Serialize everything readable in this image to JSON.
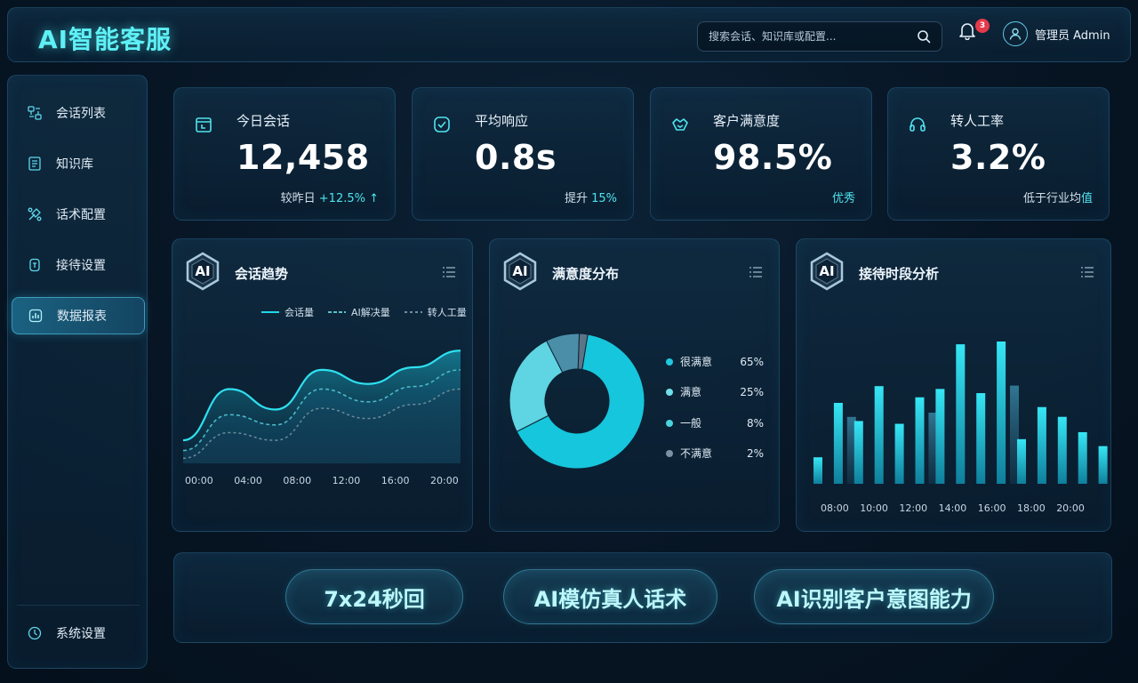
{
  "app": {
    "title": "AI智能客服"
  },
  "header": {
    "search_placeholder": "搜索会话、知识库或配置...",
    "notification_count": "3",
    "user_name": "管理员 Admin"
  },
  "sidebar": {
    "items": [
      {
        "label": "会话列表",
        "icon": "chat-list-icon"
      },
      {
        "label": "知识库",
        "icon": "knowledge-base-icon"
      },
      {
        "label": "话术配置",
        "icon": "script-config-icon"
      },
      {
        "label": "接待设置",
        "icon": "reception-icon"
      },
      {
        "label": "数据报表",
        "icon": "report-icon",
        "active": true
      }
    ],
    "footer_label": "系统设置"
  },
  "stats": [
    {
      "label": "今日会话",
      "value": "12,458",
      "note_prefix": "较昨日 ",
      "note_highlight": "+12.5% ↑"
    },
    {
      "label": "平均响应",
      "value": "0.8s",
      "note_prefix": "提升 ",
      "note_highlight": "15%"
    },
    {
      "label": "客户满意度",
      "value": "98.5%",
      "note_prefix": "",
      "note_highlight": "优秀"
    },
    {
      "label": "转人工率",
      "value": "3.2%",
      "note_prefix": "低于行业均",
      "note_highlight": "值"
    }
  ],
  "colors": {
    "accent": "#4fe3ee",
    "cyan": "#20c8e0",
    "light_cyan": "#6fe0ea",
    "teal_gray": "#4a8ea8",
    "gray": "#5d7486"
  },
  "panels": {
    "trend_title": "会话趋势",
    "satisfaction_title": "满意度分布",
    "hours_title": "接待时段分析",
    "ai_badge_text": "AI"
  },
  "chart_data": [
    {
      "type": "area",
      "title": "会话趋势",
      "x": [
        "00:00",
        "04:00",
        "08:00",
        "12:00",
        "16:00",
        "20:00"
      ],
      "series": [
        {
          "name": "会话量",
          "values": [
            0.18,
            0.58,
            0.42,
            0.73,
            0.62,
            0.75,
            0.88
          ]
        },
        {
          "name": "AI解决量",
          "values": [
            0.1,
            0.38,
            0.3,
            0.58,
            0.48,
            0.6,
            0.73
          ]
        },
        {
          "name": "转人工量",
          "values": [
            0.04,
            0.24,
            0.18,
            0.43,
            0.35,
            0.46,
            0.58
          ]
        }
      ]
    },
    {
      "type": "pie",
      "title": "满意度分布",
      "slices": [
        {
          "name": "很满意",
          "value": 65
        },
        {
          "name": "满意",
          "value": 25
        },
        {
          "name": "一般",
          "value": 8
        },
        {
          "name": "不满意",
          "value": 2
        }
      ],
      "labels": [
        "65%",
        "25%",
        "8%",
        "2%"
      ]
    },
    {
      "type": "bar",
      "title": "接待时段分析",
      "x": [
        "08:00",
        "10:00",
        "12:00",
        "14:00",
        "16:00",
        "18:00",
        "20:00"
      ],
      "values": [
        0.19,
        0.58,
        0.45,
        0.7,
        0.43,
        0.62,
        0.68,
        1.0,
        0.65,
        1.02,
        0.32,
        0.55,
        0.48,
        0.37,
        0.27
      ],
      "back_values": [
        0,
        0,
        0.47,
        0,
        0,
        0,
        0.5,
        0,
        0,
        0,
        0.69,
        0,
        0,
        0,
        0
      ]
    }
  ],
  "features": [
    "7x24秒回",
    "AI模仿真人话术",
    "AI识别客户意图能力"
  ]
}
